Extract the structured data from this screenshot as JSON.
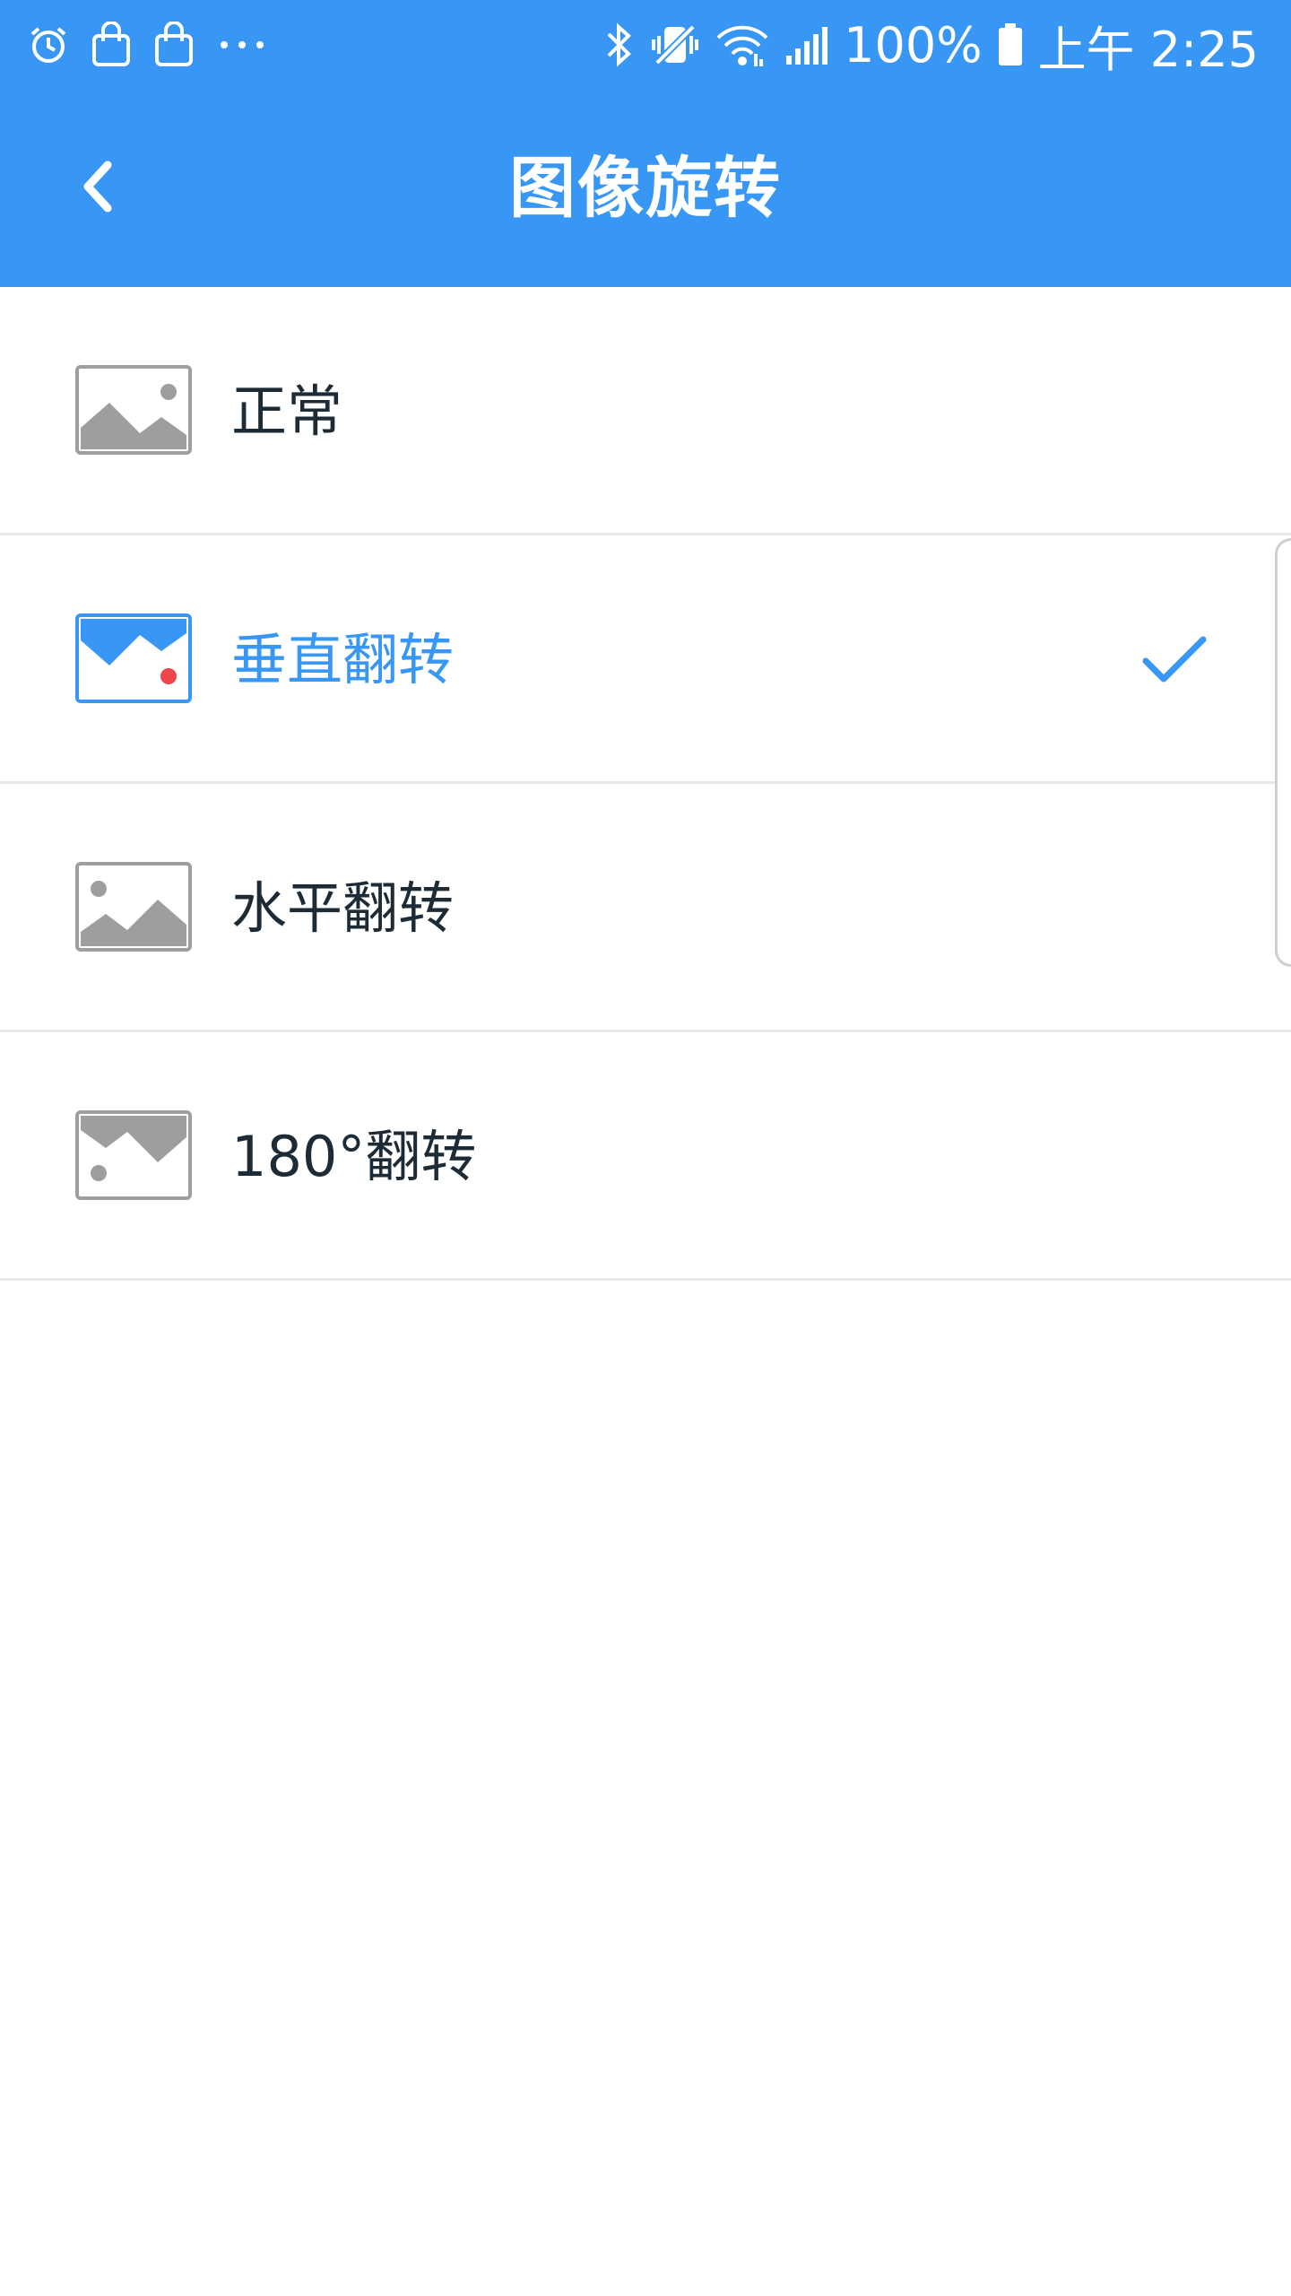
{
  "status_bar": {
    "battery": "100%",
    "time": "上午 2:25",
    "left_icons": [
      "alarm-icon",
      "shopping-bag-icon",
      "shopping-bag-icon",
      "more-dots-icon"
    ],
    "right_icons": [
      "bluetooth-icon",
      "vibrate-mute-icon",
      "wifi-icon",
      "signal-icon",
      "battery-icon"
    ]
  },
  "header": {
    "title": "图像旋转",
    "back_icon": "chevron-left-icon"
  },
  "options": [
    {
      "label": "正常",
      "icon": "image-normal-icon",
      "selected": false
    },
    {
      "label": "垂直翻转",
      "icon": "image-vertical-flip-icon",
      "selected": true
    },
    {
      "label": "水平翻转",
      "icon": "image-horizontal-flip-icon",
      "selected": false
    },
    {
      "label": "180°翻转",
      "icon": "image-rotate-180-icon",
      "selected": false
    }
  ],
  "colors": {
    "accent": "#3897f5",
    "text": "#1d2b36",
    "icon_gray": "#9e9e9e",
    "marker_red": "#f0444b",
    "divider": "#e8e8e8"
  }
}
